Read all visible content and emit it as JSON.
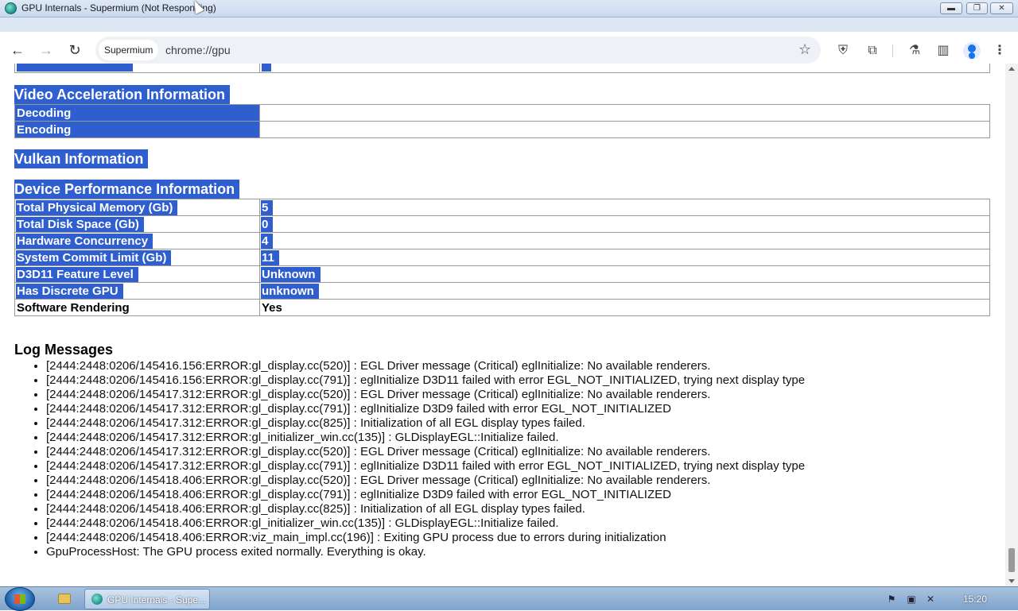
{
  "window": {
    "title": "GPU Internals - Supermium (Not Responding)",
    "tab_label": "GPU Internals",
    "minimize_glyph": "▬",
    "maximize_glyph": "❐",
    "close_glyph": "✕"
  },
  "toolbar": {
    "back_glyph": "←",
    "forward_glyph": "→",
    "reload_glyph": "↻",
    "omnibox_chip": "Supermium",
    "url": "chrome://gpu",
    "star_glyph": "☆",
    "shield_glyph": "⛨",
    "extensions_glyph": "⧉",
    "labs_glyph": "⚗",
    "side_panel_glyph": "▥",
    "menu_glyph": "⋮"
  },
  "sections": {
    "video_title": "Video Acceleration Information",
    "vulkan_title": "Vulkan Information",
    "device_title": "Device Performance Information",
    "log_title": "Log Messages"
  },
  "video_rows": [
    {
      "label": "Decoding",
      "value": ""
    },
    {
      "label": "Encoding",
      "value": ""
    }
  ],
  "device_rows": [
    {
      "label": "Total Physical Memory (Gb)",
      "value": "5"
    },
    {
      "label": "Total Disk Space (Gb)",
      "value": "0"
    },
    {
      "label": "Hardware Concurrency",
      "value": "4"
    },
    {
      "label": "System Commit Limit (Gb)",
      "value": "11"
    },
    {
      "label": "D3D11 Feature Level",
      "value": "Unknown"
    },
    {
      "label": "Has Discrete GPU",
      "value": "unknown"
    },
    {
      "label": "Software Rendering",
      "value": "Yes"
    }
  ],
  "log_messages": [
    "[2444:2448:0206/145416.156:ERROR:gl_display.cc(520)] : EGL Driver message (Critical) eglInitialize: No available renderers.",
    "[2444:2448:0206/145416.156:ERROR:gl_display.cc(791)] : eglInitialize D3D11 failed with error EGL_NOT_INITIALIZED, trying next display type",
    "[2444:2448:0206/145417.312:ERROR:gl_display.cc(520)] : EGL Driver message (Critical) eglInitialize: No available renderers.",
    "[2444:2448:0206/145417.312:ERROR:gl_display.cc(791)] : eglInitialize D3D9 failed with error EGL_NOT_INITIALIZED",
    "[2444:2448:0206/145417.312:ERROR:gl_display.cc(825)] : Initialization of all EGL display types failed.",
    "[2444:2448:0206/145417.312:ERROR:gl_initializer_win.cc(135)] : GLDisplayEGL::Initialize failed.",
    "[2444:2448:0206/145417.312:ERROR:gl_display.cc(520)] : EGL Driver message (Critical) eglInitialize: No available renderers.",
    "[2444:2448:0206/145417.312:ERROR:gl_display.cc(791)] : eglInitialize D3D11 failed with error EGL_NOT_INITIALIZED, trying next display type",
    "[2444:2448:0206/145418.406:ERROR:gl_display.cc(520)] : EGL Driver message (Critical) eglInitialize: No available renderers.",
    "[2444:2448:0206/145418.406:ERROR:gl_display.cc(791)] : eglInitialize D3D9 failed with error EGL_NOT_INITIALIZED",
    "[2444:2448:0206/145418.406:ERROR:gl_display.cc(825)] : Initialization of all EGL display types failed.",
    "[2444:2448:0206/145418.406:ERROR:gl_initializer_win.cc(135)] : GLDisplayEGL::Initialize failed.",
    "[2444:2448:0206/145418.406:ERROR:viz_main_impl.cc(196)] : Exiting GPU process due to errors during initialization",
    "GpuProcessHost: The GPU process exited normally. Everything is okay."
  ],
  "taskbar": {
    "task_label": "GPU Internals - Supe...",
    "clock": "15:20",
    "flag_glyph": "⚑",
    "network_glyph": "▣",
    "volume_glyph": "✕"
  },
  "colors": {
    "selection": "#2f5fcf",
    "selection_text": "#ffffff"
  }
}
